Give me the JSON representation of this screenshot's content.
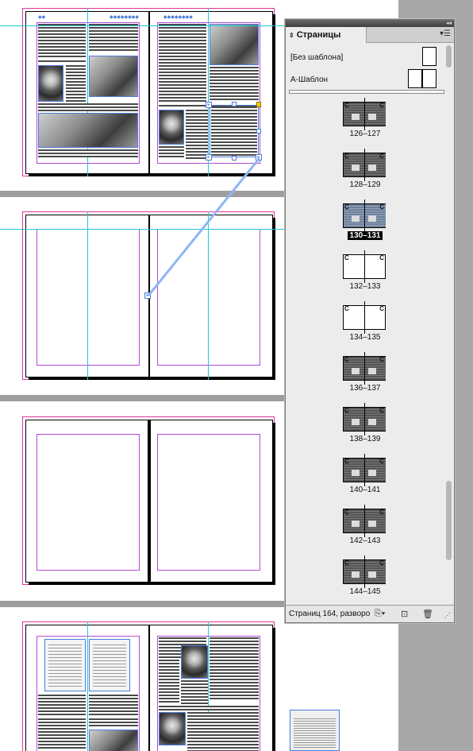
{
  "window": {
    "title": ""
  },
  "panel": {
    "tab_label": "Страницы",
    "menu_icon": "panel-menu-icon",
    "collapse_icon": "double-arrow-icon",
    "masters": [
      {
        "label": "[Без шаблона]"
      },
      {
        "label": "А-Шаблон"
      }
    ],
    "spreads": [
      {
        "label": "126–127",
        "thumb": "content",
        "selected": false
      },
      {
        "label": "128–129",
        "thumb": "content",
        "selected": false
      },
      {
        "label": "130–131",
        "thumb": "content",
        "selected": true
      },
      {
        "label": "132–133",
        "thumb": "empty",
        "selected": false
      },
      {
        "label": "134–135",
        "thumb": "empty",
        "selected": false
      },
      {
        "label": "136–137",
        "thumb": "content",
        "selected": false
      },
      {
        "label": "138–139",
        "thumb": "content",
        "selected": false
      },
      {
        "label": "140–141",
        "thumb": "content",
        "selected": false
      },
      {
        "label": "142–143",
        "thumb": "content",
        "selected": false
      },
      {
        "label": "144–145",
        "thumb": "content",
        "selected": false
      }
    ],
    "master_prefix_letter": "С",
    "status_text": "Страниц 164, разворо",
    "status_icons": [
      "edit-page-size-icon",
      "new-page-icon",
      "trash-icon"
    ]
  },
  "colors": {
    "guide": "#21c6d6",
    "margin": "#b34bd6",
    "bleed": "#e0349b",
    "frame": "#4d7bd8",
    "thread": "#8fb6f2",
    "pasteboard_gray": "#a8a8a8"
  }
}
